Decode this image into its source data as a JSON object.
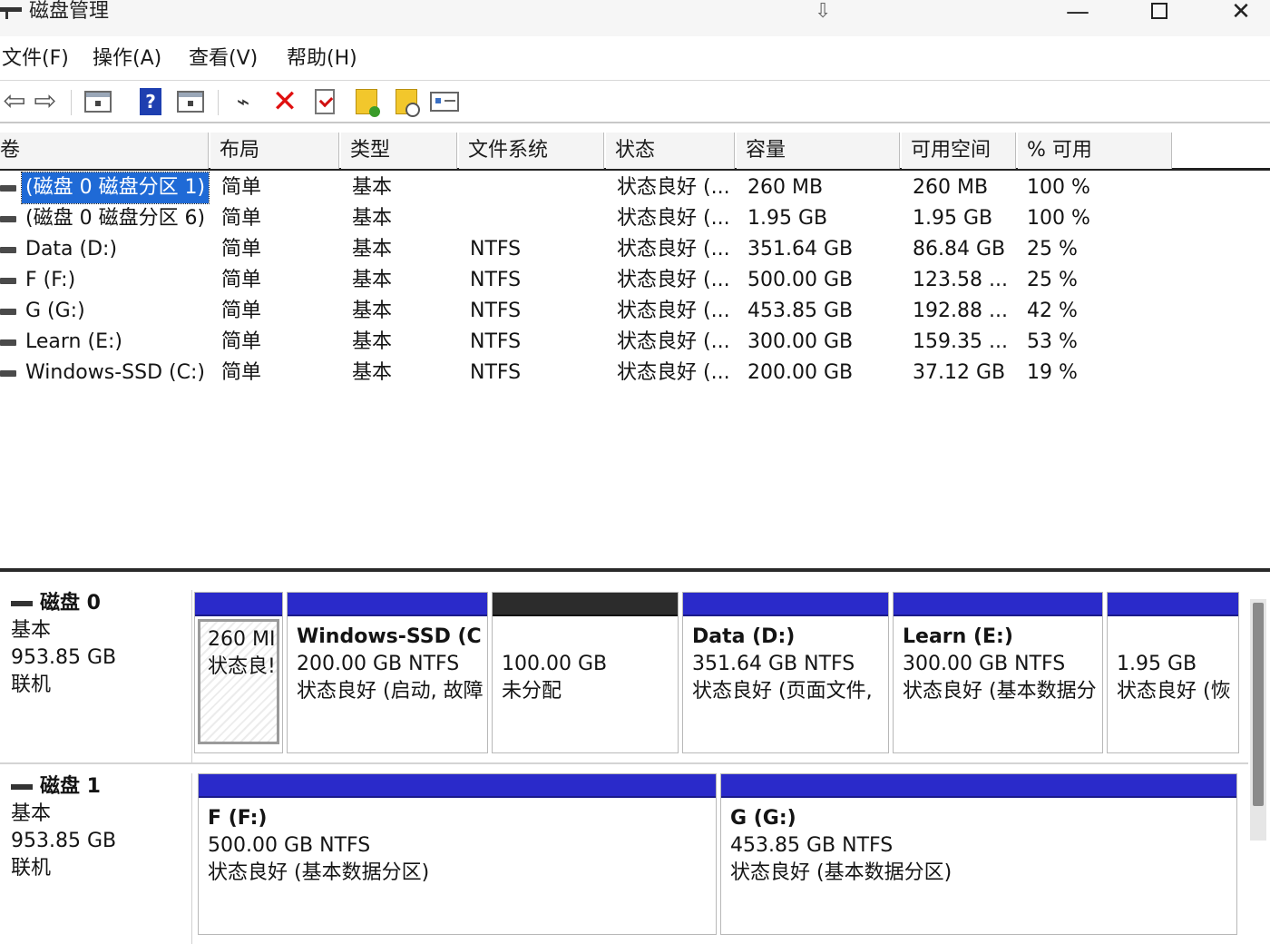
{
  "window": {
    "title": "磁盘管理",
    "center_icon": "⇩",
    "controls": {
      "minimize": "—",
      "close": "✕"
    }
  },
  "menu": [
    "文件(F)",
    "操作(A)",
    "查看(V)",
    "帮助(H)"
  ],
  "toolbar": {
    "icons": [
      "back-icon",
      "forward-icon",
      "console-tree-icon",
      "help-icon",
      "details-icon",
      "connect-icon",
      "delete-icon",
      "check-icon",
      "folder-add-icon",
      "folder-search-icon",
      "properties-icon"
    ]
  },
  "volume_list": {
    "columns": [
      "卷",
      "布局",
      "类型",
      "文件系统",
      "状态",
      "容量",
      "可用空间",
      "% 可用"
    ],
    "rows": [
      {
        "volume": "(磁盘 0 磁盘分区 1)",
        "layout": "简单",
        "type": "基本",
        "fs": "",
        "status": "状态良好 (...",
        "capacity": "260 MB",
        "free": "260 MB",
        "pct": "100 %",
        "selected": true
      },
      {
        "volume": "(磁盘 0 磁盘分区 6)",
        "layout": "简单",
        "type": "基本",
        "fs": "",
        "status": "状态良好 (...",
        "capacity": "1.95 GB",
        "free": "1.95 GB",
        "pct": "100 %"
      },
      {
        "volume": "Data (D:)",
        "layout": "简单",
        "type": "基本",
        "fs": "NTFS",
        "status": "状态良好 (...",
        "capacity": "351.64 GB",
        "free": "86.84 GB",
        "pct": "25 %"
      },
      {
        "volume": "F (F:)",
        "layout": "简单",
        "type": "基本",
        "fs": "NTFS",
        "status": "状态良好 (...",
        "capacity": "500.00 GB",
        "free": "123.58 ...",
        "pct": "25 %"
      },
      {
        "volume": "G (G:)",
        "layout": "简单",
        "type": "基本",
        "fs": "NTFS",
        "status": "状态良好 (...",
        "capacity": "453.85 GB",
        "free": "192.88 ...",
        "pct": "42 %"
      },
      {
        "volume": "Learn (E:)",
        "layout": "简单",
        "type": "基本",
        "fs": "NTFS",
        "status": "状态良好 (...",
        "capacity": "300.00 GB",
        "free": "159.35 ...",
        "pct": "53 %"
      },
      {
        "volume": "Windows-SSD (C:)",
        "layout": "简单",
        "type": "基本",
        "fs": "NTFS",
        "status": "状态良好 (...",
        "capacity": "200.00 GB",
        "free": "37.12 GB",
        "pct": "19 %"
      }
    ]
  },
  "disks": [
    {
      "name": "磁盘 0",
      "type": "基本",
      "size": "953.85 GB",
      "state": "联机",
      "partitions": [
        {
          "name": "",
          "size": "260 MI",
          "status": "状态良!",
          "kind": "system",
          "hatched": true
        },
        {
          "name": "Windows-SSD  (C",
          "size": "200.00 GB NTFS",
          "status": "状态良好 (启动, 故障",
          "kind": "primary"
        },
        {
          "name": "",
          "size": "100.00 GB",
          "status": "未分配",
          "kind": "unallocated"
        },
        {
          "name": "Data  (D:)",
          "size": "351.64 GB NTFS",
          "status": "状态良好 (页面文件,",
          "kind": "primary"
        },
        {
          "name": "Learn  (E:)",
          "size": "300.00 GB NTFS",
          "status": "状态良好 (基本数据分",
          "kind": "primary"
        },
        {
          "name": "",
          "size": "1.95 GB",
          "status": "状态良好 (恢",
          "kind": "primary"
        }
      ]
    },
    {
      "name": "磁盘 1",
      "type": "基本",
      "size": "953.85 GB",
      "state": "联机",
      "partitions": [
        {
          "name": "F  (F:)",
          "size": "500.00 GB NTFS",
          "status": "状态良好 (基本数据分区)",
          "kind": "primary"
        },
        {
          "name": "G  (G:)",
          "size": "453.85 GB NTFS",
          "status": "状态良好 (基本数据分区)",
          "kind": "primary"
        }
      ]
    }
  ],
  "colors": {
    "partition_bar": "#2a2aca",
    "unallocated_bar": "#2c2c2c",
    "selection": "#1f6ad6"
  }
}
